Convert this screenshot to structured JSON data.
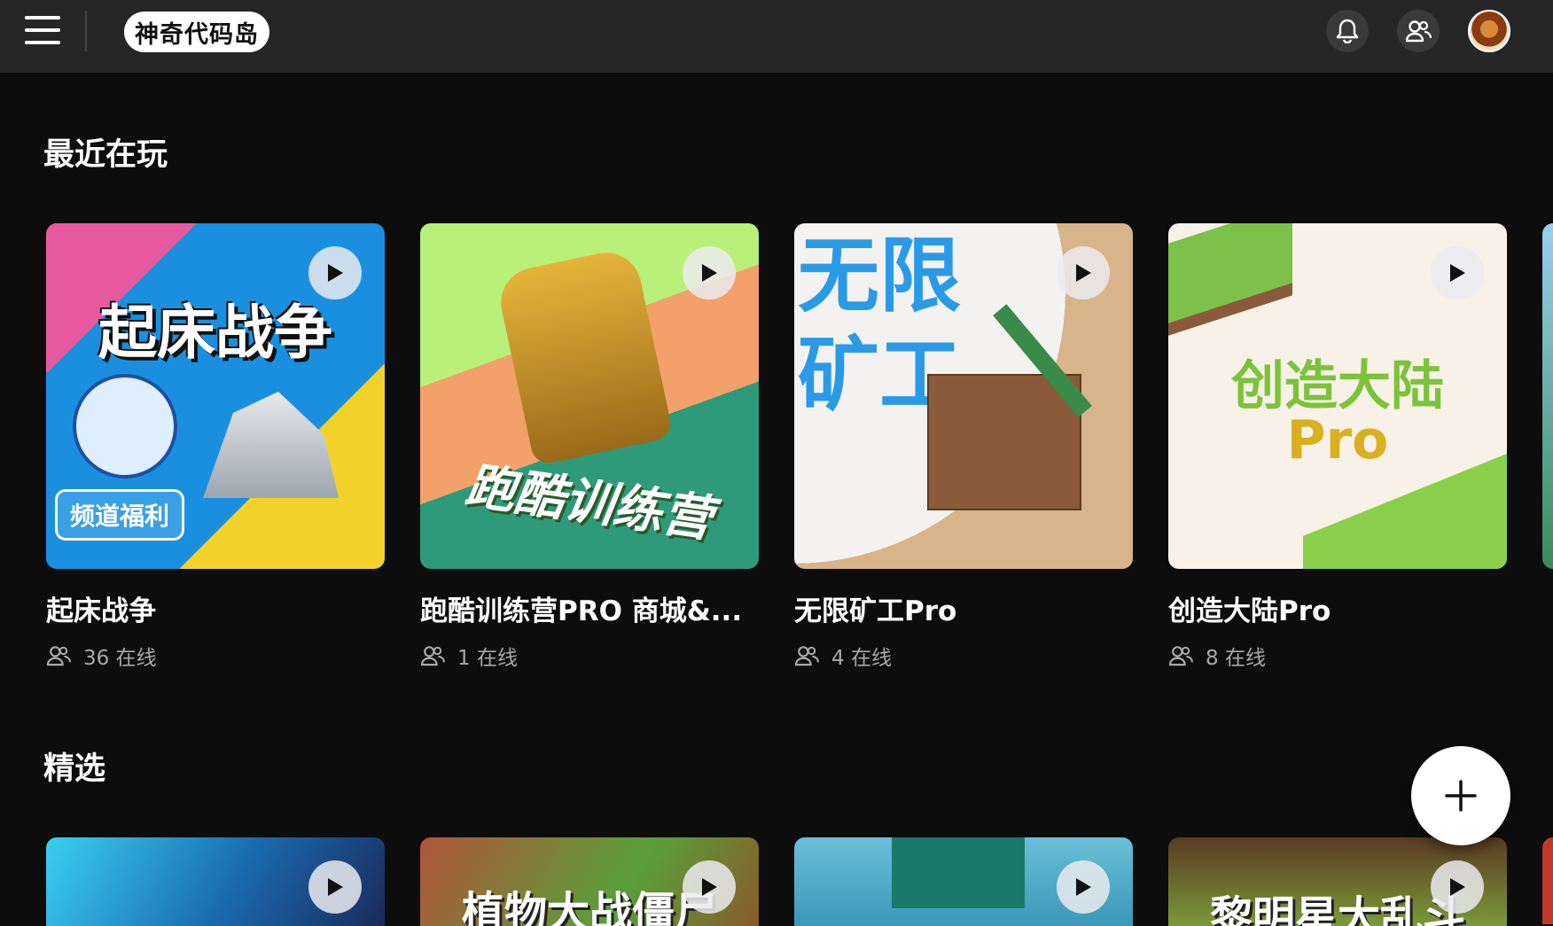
{
  "header": {
    "logo_text": "神奇代码岛",
    "icons": [
      "menu-icon",
      "bell-icon",
      "friends-icon"
    ]
  },
  "sections": {
    "recent": {
      "title": "最近在玩",
      "cards": [
        {
          "thumb_title": "起床战争",
          "thumb_badge": "频道福利",
          "name": "起床战争",
          "online": "36 在线"
        },
        {
          "thumb_title": "跑酷训练营",
          "name": "跑酷训练营PRO 商城&...",
          "online": "1 在线"
        },
        {
          "thumb_title": "无限矿工",
          "name": "无限矿工Pro",
          "online": "4 在线"
        },
        {
          "thumb_title": "创造大陆",
          "thumb_subtitle": "Pro",
          "name": "创造大陆Pro",
          "online": "8 在线"
        }
      ]
    },
    "featured": {
      "title": "精选",
      "cards": [
        {
          "thumb_title": ""
        },
        {
          "thumb_title": "植物大战僵尸"
        },
        {
          "thumb_title": ""
        },
        {
          "thumb_title": "黎明星大乱斗"
        }
      ]
    }
  },
  "fab": {
    "icon": "plus-icon"
  },
  "colors": {
    "background": "#0d0d0d",
    "topbar": "#262626",
    "meta_text": "#a9a9a9"
  }
}
